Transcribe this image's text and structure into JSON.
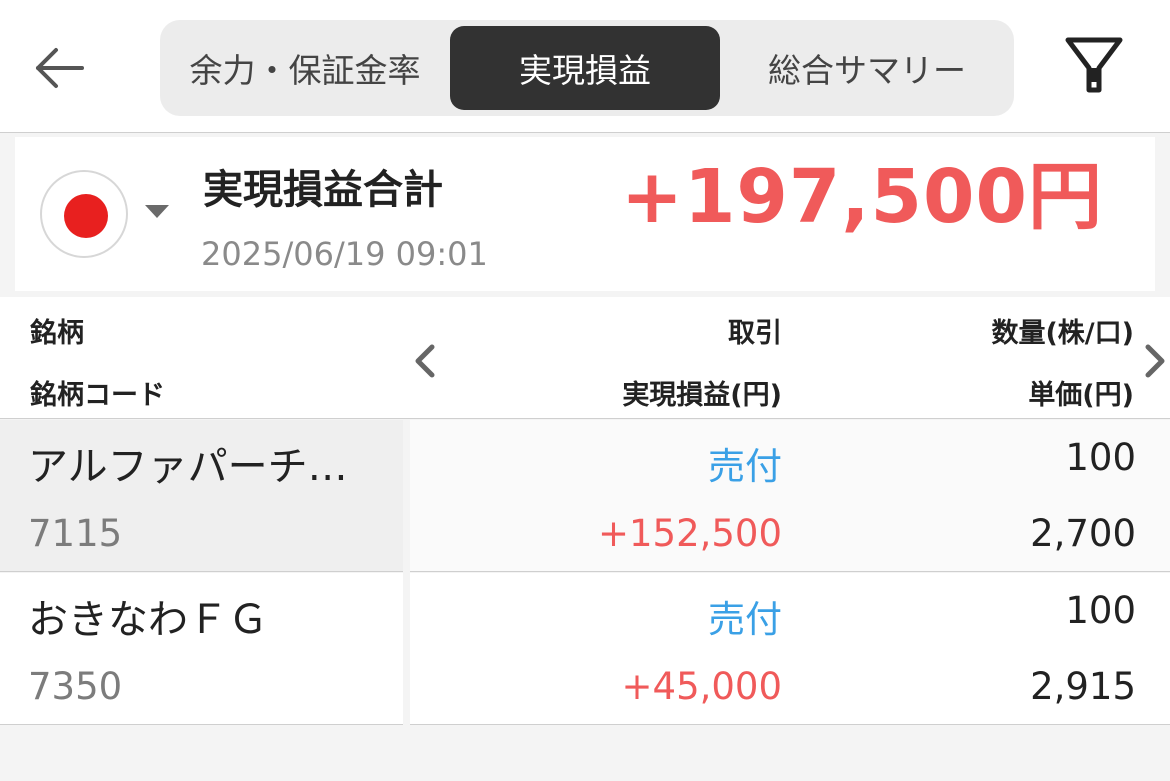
{
  "header": {
    "tabs": [
      {
        "label": "余力・保証金率",
        "active": false
      },
      {
        "label": "実現損益",
        "active": true
      },
      {
        "label": "総合サマリー",
        "active": false
      }
    ],
    "icons": {
      "back": "back-arrow-icon",
      "filter": "filter-icon"
    }
  },
  "summary": {
    "market_flag": "japan-flag-icon",
    "label": "実現損益合計",
    "date": "2025/06/19 09:01",
    "total": "+197,500円"
  },
  "columns": {
    "name": "銘柄",
    "code": "銘柄コード",
    "trade": "取引",
    "pnl": "実現損益(円)",
    "qty": "数量(株/口)",
    "price": "単価(円)"
  },
  "rows": [
    {
      "name": "アルファパーチ…",
      "code": "7115",
      "trade": "売付",
      "pnl": "+152,500",
      "qty": "100",
      "price": "2,700"
    },
    {
      "name": "おきなわＦＧ",
      "code": "7350",
      "trade": "売付",
      "pnl": "+45,000",
      "qty": "100",
      "price": "2,915"
    }
  ],
  "colors": {
    "positive": "#f05a5a",
    "trade": "#3aa0e6",
    "active_tab": "#323232"
  }
}
